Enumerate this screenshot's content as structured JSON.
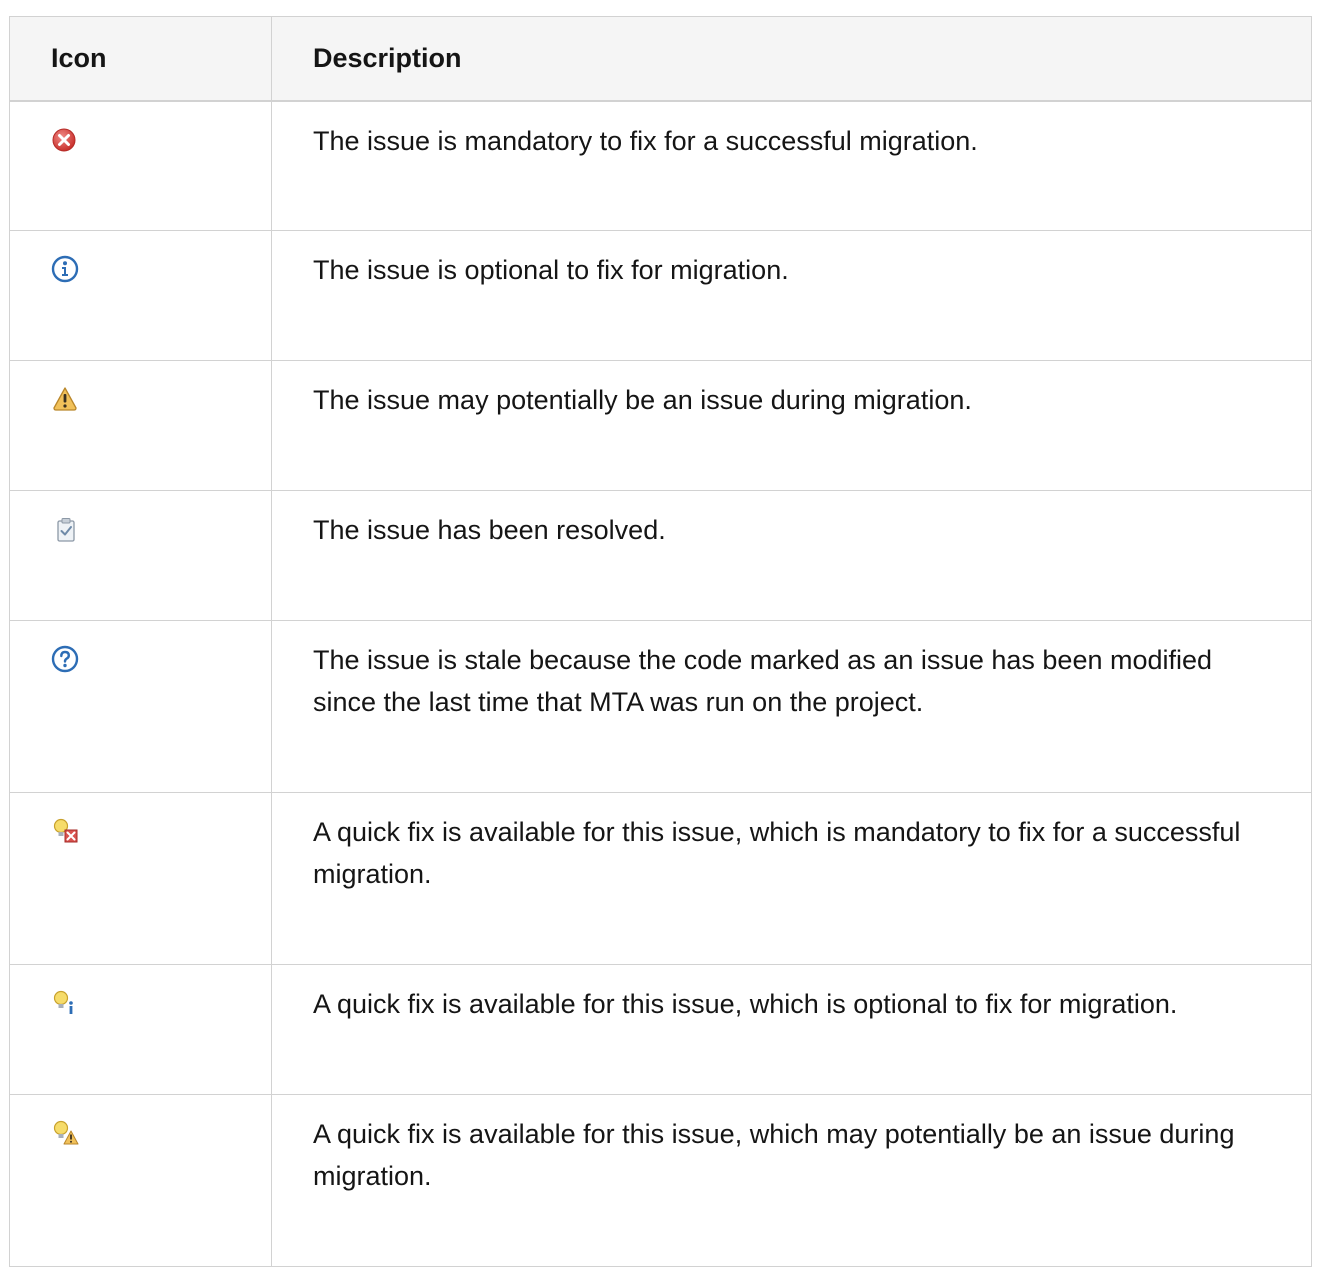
{
  "table": {
    "headers": {
      "icon": "Icon",
      "description": "Description"
    },
    "rows": [
      {
        "icon": "error-icon",
        "description": "The issue is mandatory to fix for a successful migration."
      },
      {
        "icon": "info-icon",
        "description": "The issue is optional to fix for migration."
      },
      {
        "icon": "warning-icon",
        "description": "The issue may potentially be an issue during migration."
      },
      {
        "icon": "resolved-clipboard-icon",
        "description": "The issue has been resolved."
      },
      {
        "icon": "question-icon",
        "description": "The issue is stale because the code marked as an issue has been modified since the last time that MTA was run on the project."
      },
      {
        "icon": "quickfix-error-icon",
        "description": "A quick fix is available for this issue, which is mandatory to fix for a successful migration."
      },
      {
        "icon": "quickfix-info-icon",
        "description": "A quick fix is available for this issue, which is optional to fix for migration."
      },
      {
        "icon": "quickfix-warning-icon",
        "description": "A quick fix is available for this issue, which may potentially be an issue during migration."
      }
    ]
  },
  "colors": {
    "error_red": "#d9534f",
    "info_blue": "#2d6db5",
    "warning_amber": "#e8a93a",
    "bulb_yellow": "#f3d35a",
    "header_bg": "#f5f5f5",
    "border": "#d2d2d2"
  }
}
